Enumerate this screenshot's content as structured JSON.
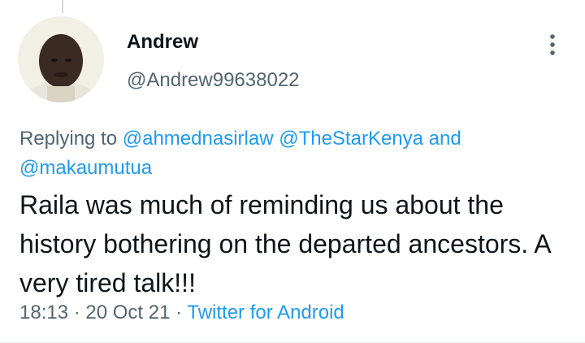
{
  "tweet": {
    "author": {
      "name": "Andrew",
      "handle": "@Andrew99638022"
    },
    "reply": {
      "prefix": "Replying to ",
      "mentions": [
        "@ahmednasirlaw",
        "@TheStarKenya",
        "@makaumutua"
      ],
      "joiner": " and"
    },
    "text": "Raila was much of reminding us about the history bothering on the departed ancestors. A very tired talk!!!",
    "meta": {
      "time": "18:13",
      "date": "20 Oct 21",
      "separator": " · ",
      "source": "Twitter for Android"
    }
  },
  "icons": {
    "more": "more-vertical-icon"
  },
  "colors": {
    "accent": "#1d9bf0",
    "secondary_text": "#536471",
    "primary_text": "#0f1419"
  }
}
